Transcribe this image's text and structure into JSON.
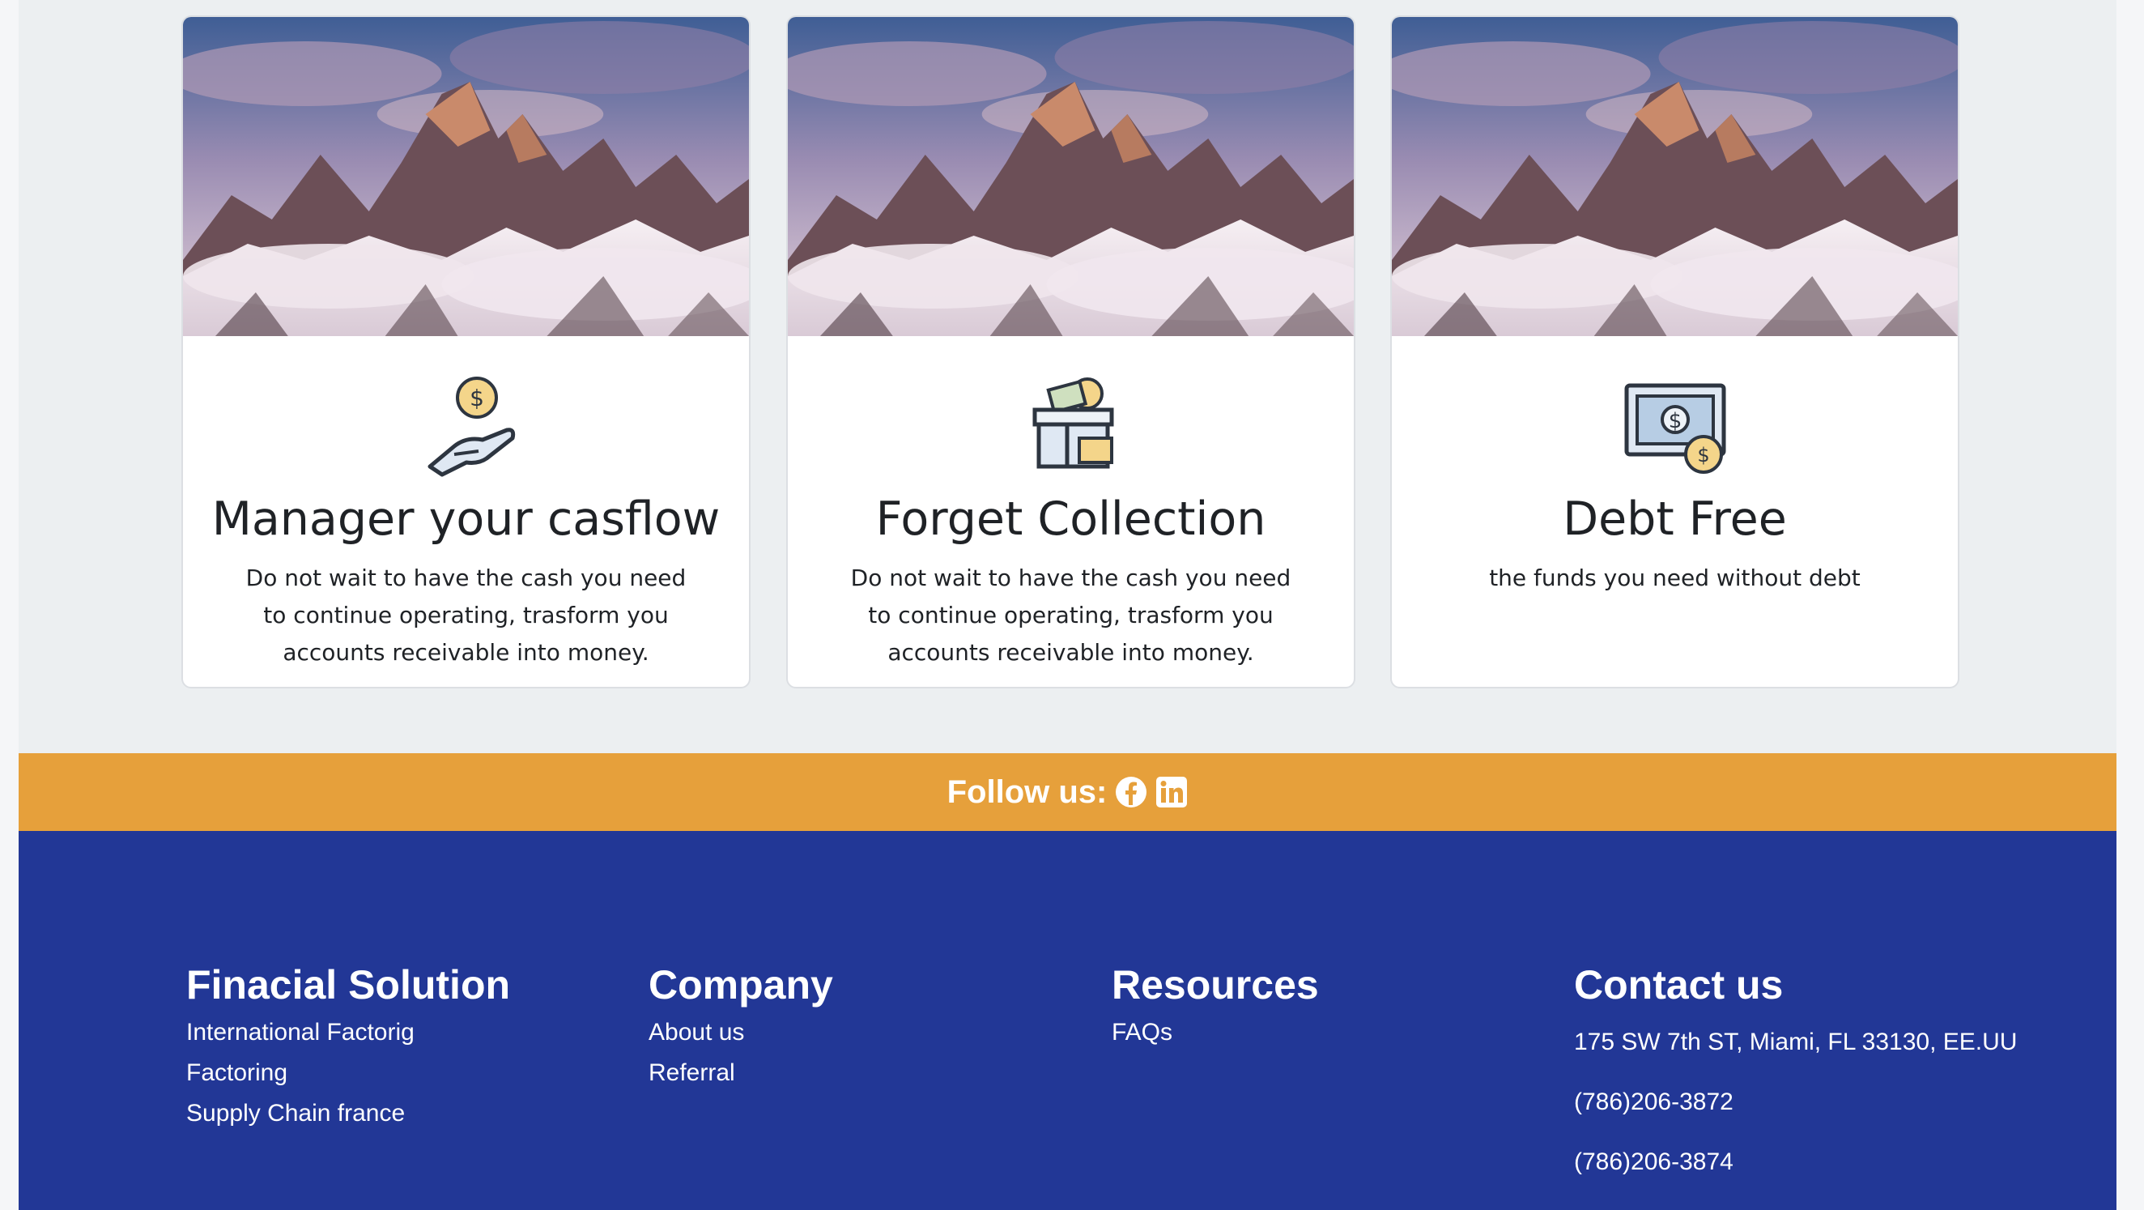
{
  "cards": [
    {
      "icon": "hand-coin-icon",
      "title": "Manager your casflow",
      "text": "Do not wait to have the cash you need to continue operating, trasform you accounts receivable into money."
    },
    {
      "icon": "cash-box-icon",
      "title": "Forget Collection",
      "text": "Do not wait to have the cash you need to continue operating, trasform you accounts receivable into money."
    },
    {
      "icon": "dollar-bill-icon",
      "title": "Debt Free",
      "text": "the funds you need without debt"
    }
  ],
  "follow": {
    "label": "Follow us:",
    "icons": [
      "facebook-icon",
      "linkedin-icon"
    ],
    "bar_color": "#e6a03b"
  },
  "footer": {
    "background": "#223796",
    "financial": {
      "heading": "Finacial Solution",
      "links": [
        "International Factorig",
        "Factoring",
        "Supply Chain france"
      ]
    },
    "company": {
      "heading": "Company",
      "links": [
        "About us",
        "Referral"
      ]
    },
    "resources": {
      "heading": "Resources",
      "links": [
        "FAQs"
      ]
    },
    "contact": {
      "heading": "Contact us",
      "address": "175 SW 7th ST, Miami, FL 33130, EE.UU",
      "phone1": "(786)206-3872",
      "phone2": "(786)206-3874"
    }
  }
}
